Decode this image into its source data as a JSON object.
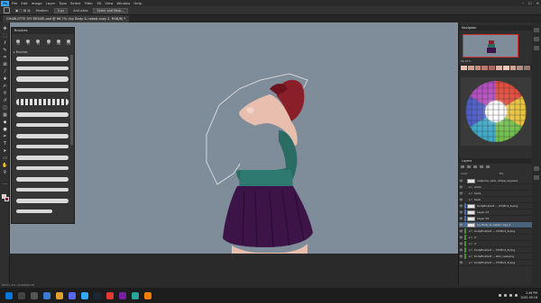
{
  "menu": {
    "app_icon": "Ps",
    "items": [
      "File",
      "Edit",
      "Image",
      "Layer",
      "Type",
      "Select",
      "Filter",
      "3D",
      "View",
      "Window",
      "Help"
    ]
  },
  "options": {
    "feather_label": "Feather:",
    "feather_value": "0 px",
    "antialias_label": "Anti-alias",
    "select_mask_button": "Select and Mask..."
  },
  "document_tab": "CHARLOTTE IVY RESIZE.psd @ 66.7% (Ivy Body & naked copy 2, RGB/8) *",
  "brushes_panel": {
    "title": "Brushes",
    "sizes": [
      "10",
      "25",
      "50",
      "75",
      "100",
      "125"
    ],
    "folder_label": "Brushes"
  },
  "right_panels": {
    "navigator": "Navigator",
    "navigator_zoom": "66.67%",
    "swatches": "Swatches",
    "layers": "Layers",
    "lock_label": "Lock:",
    "fill_label": "Fill:"
  },
  "layers": [
    {
      "name": "costume, pink, stripe, layered",
      "visible": true,
      "type": "thumb",
      "bar": ""
    },
    {
      "name": "arms",
      "visible": true,
      "type": "folder",
      "bar": ""
    },
    {
      "name": "hairs",
      "visible": true,
      "type": "folder",
      "bar": ""
    },
    {
      "name": "back",
      "visible": true,
      "type": "folder",
      "bar": ""
    },
    {
      "name": "bodyfinal/art ... 23d5c4_6.png",
      "visible": true,
      "type": "thumb",
      "bar": "#4a6fa5"
    },
    {
      "name": "Layer 23",
      "visible": true,
      "type": "thumb",
      "bar": "#4a6fa5"
    },
    {
      "name": "Layer 24",
      "visible": true,
      "type": "thumb",
      "bar": "#4a6fa5"
    },
    {
      "name": "Ivy Body & naked copy 2",
      "visible": true,
      "type": "thumb",
      "bar": "#4a6fa5",
      "selected": true
    },
    {
      "name": "bodyfinal/art ... 23d5c4_6.png",
      "visible": true,
      "type": "folder",
      "bar": "#4e8a3e"
    },
    {
      "name": "2",
      "visible": true,
      "type": "folder",
      "bar": "#4e8a3e"
    },
    {
      "name": "3",
      "visible": true,
      "type": "folder",
      "bar": "#4e8a3e"
    },
    {
      "name": "bodyfinal/art ... 23d5c4_6.png",
      "visible": true,
      "type": "folder",
      "bar": "#4e8a3e"
    },
    {
      "name": "bodyfinal/art ... skin_new.png",
      "visible": true,
      "type": "folder",
      "bar": "#4e8a3e"
    },
    {
      "name": "bodyfinal/art ... 23d5c4_6.png",
      "visible": true,
      "type": "folder",
      "bar": ""
    }
  ],
  "status": "66.67%    Doc: 25.4M/663.2M",
  "clock": {
    "time": "2:49 PM",
    "date": "2022-09-18"
  },
  "colors": {
    "canvas_bg": "#7f8c99",
    "skin": "#e8bfae",
    "hair": "#8a1f2a",
    "top": "#2a6b64",
    "skirt": "#3d1448",
    "accent": "#31a8ff"
  }
}
